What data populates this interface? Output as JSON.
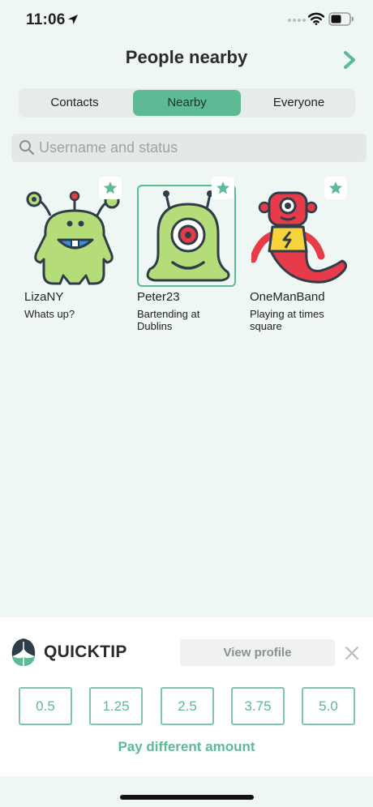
{
  "status_bar": {
    "time": "11:06",
    "icons": [
      "location-arrow-icon",
      "signal-dots-icon",
      "wifi-icon",
      "battery-icon"
    ]
  },
  "header": {
    "title": "People nearby",
    "next_icon": "chevron-right-icon"
  },
  "tabs": [
    {
      "label": "Contacts",
      "selected": false
    },
    {
      "label": "Nearby",
      "selected": true
    },
    {
      "label": "Everyone",
      "selected": false
    }
  ],
  "search": {
    "placeholder": "Username and status",
    "value": ""
  },
  "people": [
    {
      "name": "LizaNY",
      "status": "Whats up?",
      "favorite": true,
      "selected": false,
      "avatar": "green-antenna-monster"
    },
    {
      "name": "Peter23",
      "status": "Bartending at Dublins",
      "favorite": true,
      "selected": true,
      "avatar": "green-one-eyed-blob"
    },
    {
      "name": "OneManBand",
      "status": "Playing at times square",
      "favorite": true,
      "selected": false,
      "avatar": "red-snake-robot"
    }
  ],
  "quicktip": {
    "brand": "QUICKTIP",
    "view_profile": "View profile",
    "amounts": [
      "0.5",
      "1.25",
      "2.5",
      "3.75",
      "5.0"
    ],
    "pay_different": "Pay different amount"
  },
  "colors": {
    "accent": "#5dba94",
    "background": "#eff7f4",
    "avatar_green": "#b4dc78",
    "avatar_red": "#e83b4a",
    "avatar_yellow": "#f8d43c"
  }
}
